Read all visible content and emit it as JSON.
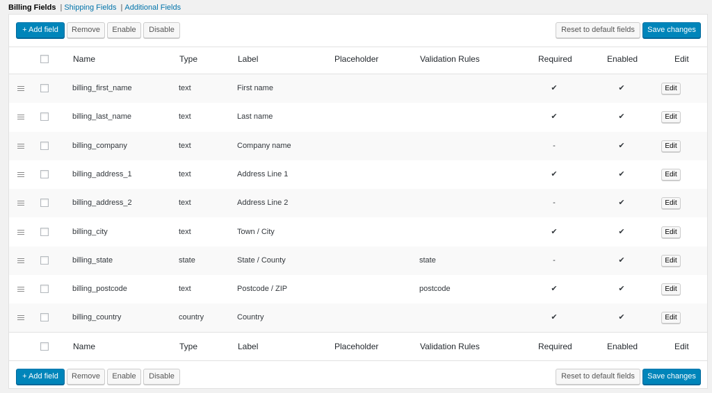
{
  "tabs": {
    "billing": "Billing Fields",
    "shipping": "Shipping Fields",
    "additional": "Additional Fields",
    "separator": "|"
  },
  "toolbar": {
    "add_field": "+ Add field",
    "remove": "Remove",
    "enable": "Enable",
    "disable": "Disable",
    "reset": "Reset to default fields",
    "save": "Save changes"
  },
  "columns": {
    "name": "Name",
    "type": "Type",
    "label": "Label",
    "placeholder": "Placeholder",
    "validation": "Validation Rules",
    "required": "Required",
    "enabled": "Enabled",
    "edit": "Edit"
  },
  "edit_label": "Edit",
  "rows": [
    {
      "name": "billing_first_name",
      "type": "text",
      "label": "First name",
      "placeholder": "",
      "validation": "",
      "required": "✔",
      "enabled": "✔"
    },
    {
      "name": "billing_last_name",
      "type": "text",
      "label": "Last name",
      "placeholder": "",
      "validation": "",
      "required": "✔",
      "enabled": "✔"
    },
    {
      "name": "billing_company",
      "type": "text",
      "label": "Company name",
      "placeholder": "",
      "validation": "",
      "required": "-",
      "enabled": "✔"
    },
    {
      "name": "billing_address_1",
      "type": "text",
      "label": "Address Line 1",
      "placeholder": "",
      "validation": "",
      "required": "✔",
      "enabled": "✔"
    },
    {
      "name": "billing_address_2",
      "type": "text",
      "label": "Address Line 2",
      "placeholder": "",
      "validation": "",
      "required": "-",
      "enabled": "✔"
    },
    {
      "name": "billing_city",
      "type": "text",
      "label": "Town / City",
      "placeholder": "",
      "validation": "",
      "required": "✔",
      "enabled": "✔"
    },
    {
      "name": "billing_state",
      "type": "state",
      "label": "State / County",
      "placeholder": "",
      "validation": "state",
      "required": "-",
      "enabled": "✔"
    },
    {
      "name": "billing_postcode",
      "type": "text",
      "label": "Postcode / ZIP",
      "placeholder": "",
      "validation": "postcode",
      "required": "✔",
      "enabled": "✔"
    },
    {
      "name": "billing_country",
      "type": "country",
      "label": "Country",
      "placeholder": "",
      "validation": "",
      "required": "✔",
      "enabled": "✔"
    }
  ],
  "colors": {
    "primary_button": "#0085ba",
    "link": "#0073aa",
    "row_alt": "#f9f9f9"
  },
  "icons": {
    "drag": "drag-handle-icon",
    "check": "checkmark-icon"
  }
}
